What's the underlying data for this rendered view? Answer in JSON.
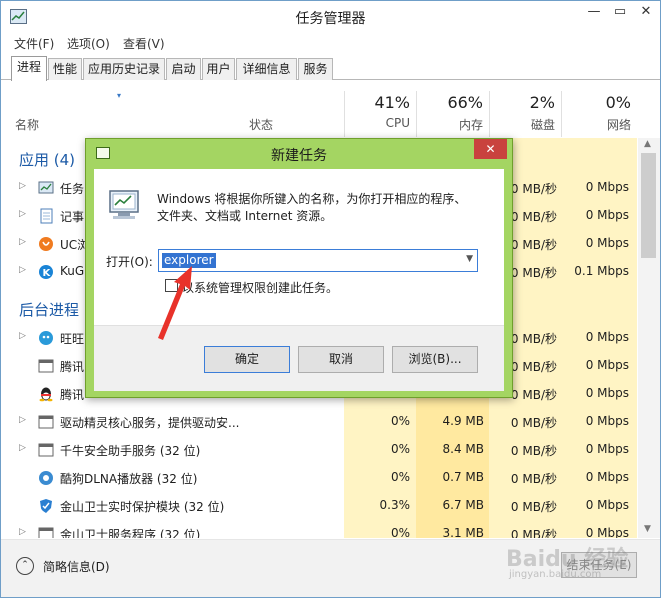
{
  "window": {
    "title": "任务管理器",
    "controls": {
      "minimize": "—",
      "maximize": "▭",
      "close": "✕"
    }
  },
  "menu": [
    "文件(F)",
    "选项(O)",
    "查看(V)"
  ],
  "tabs": [
    "进程",
    "性能",
    "应用历史记录",
    "启动",
    "用户",
    "详细信息",
    "服务"
  ],
  "header": {
    "name": "名称",
    "status": "状态",
    "cpu": {
      "pct": "41%",
      "label": "CPU"
    },
    "memory": {
      "pct": "66%",
      "label": "内存"
    },
    "disk": {
      "pct": "2%",
      "label": "磁盘"
    },
    "network": {
      "pct": "0%",
      "label": "网络"
    }
  },
  "groups": {
    "apps": "应用 (4)",
    "background": "后台进程"
  },
  "app_rows": [
    {
      "name": "任务",
      "cpu": "",
      "mem": "",
      "disk": "0 MB/秒",
      "net": "0 Mbps",
      "icon": "taskmgr-icon"
    },
    {
      "name": "记事",
      "cpu": "",
      "mem": "",
      "disk": "0 MB/秒",
      "net": "0 Mbps",
      "icon": "notepad-icon"
    },
    {
      "name": "UC浏",
      "cpu": "",
      "mem": "",
      "disk": "0 MB/秒",
      "net": "0 Mbps",
      "icon": "uc-browser-icon"
    },
    {
      "name": "KuG",
      "cpu": "",
      "mem": "",
      "disk": "0 MB/秒",
      "net": "0.1 Mbps",
      "icon": "kugou-icon"
    }
  ],
  "bg_rows": [
    {
      "name": "旺旺",
      "cpu": "",
      "mem": "",
      "disk": "0 MB/秒",
      "net": "0 Mbps",
      "icon": "wangwang-icon"
    },
    {
      "name": "腾讯",
      "cpu": "",
      "mem": "",
      "disk": "0 MB/秒",
      "net": "0 Mbps",
      "icon": "generic-app-icon"
    },
    {
      "name": "腾讯",
      "cpu": "",
      "mem": "",
      "disk": "0 MB/秒",
      "net": "0 Mbps",
      "icon": "qq-icon"
    },
    {
      "name": "驱动精灵核心服务，提供驱动安...",
      "cpu": "0%",
      "mem": "4.9 MB",
      "disk": "0 MB/秒",
      "net": "0 Mbps",
      "icon": "generic-app-icon"
    },
    {
      "name": "千牛安全助手服务 (32 位)",
      "cpu": "0%",
      "mem": "8.4 MB",
      "disk": "0 MB/秒",
      "net": "0 Mbps",
      "icon": "generic-app-icon"
    },
    {
      "name": "酷狗DLNA播放器 (32 位)",
      "cpu": "0%",
      "mem": "0.7 MB",
      "disk": "0 MB/秒",
      "net": "0 Mbps",
      "icon": "kugou-dlna-icon"
    },
    {
      "name": "金山卫士实时保护模块 (32 位)",
      "cpu": "0.3%",
      "mem": "6.7 MB",
      "disk": "0 MB/秒",
      "net": "0 Mbps",
      "icon": "shield-icon"
    },
    {
      "name": "金山卫士服务程序 (32 位)",
      "cpu": "0%",
      "mem": "3.1 MB",
      "disk": "0 MB/秒",
      "net": "0 Mbps",
      "icon": "generic-app-icon"
    }
  ],
  "footer": {
    "more_label": "简略信息(D)",
    "more_icon": "⌃",
    "end_task": "结束任务(E)"
  },
  "dialog": {
    "title": "新建任务",
    "close": "✕",
    "description": "Windows 将根据你所键入的名称，为你打开相应的程序、文件夹、文档或 Internet 资源。",
    "open_label": "打开(O):",
    "open_value": "explorer",
    "checkbox_label": "以系统管理权限创建此任务。",
    "ok": "确定",
    "cancel": "取消",
    "browse": "浏览(B)..."
  },
  "watermark": {
    "main": "Baidu 经验",
    "sub": "jingyan.baidu.com"
  },
  "colors": {
    "accent_blue": "#1c5aa6",
    "dialog_frame": "#a4d562",
    "close_red": "#c9423e",
    "heat_light": "#fff4c4",
    "heat_mid": "#ffe9a0",
    "annotation_red": "#e8322a"
  }
}
